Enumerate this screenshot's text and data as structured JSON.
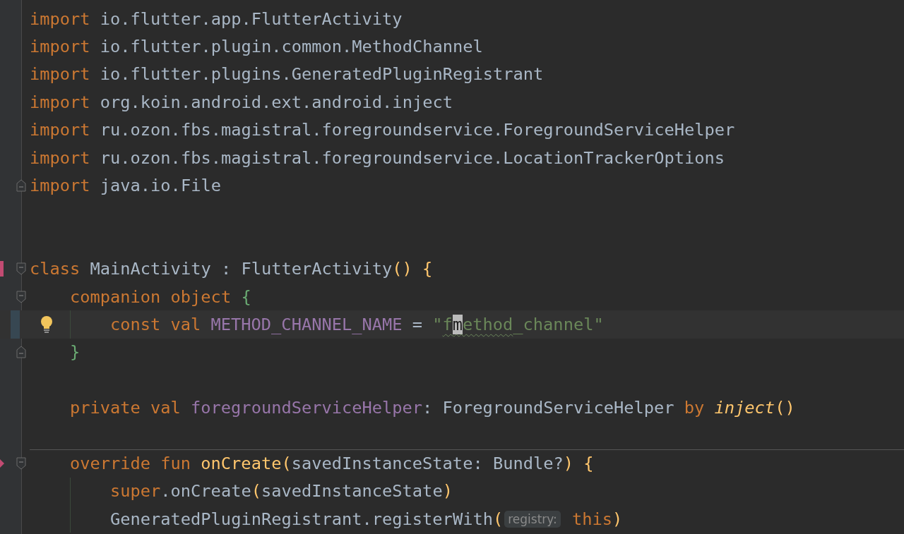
{
  "editor": {
    "lines": [
      {
        "kind": "code",
        "tokens": [
          {
            "kind": "kw",
            "text": "import"
          },
          {
            "kind": "plain",
            "text": "io.flutter.app.FlutterActivity",
            "space": true
          }
        ]
      },
      {
        "kind": "code",
        "tokens": [
          {
            "kind": "kw",
            "text": "import"
          },
          {
            "kind": "plain",
            "text": "io.flutter.plugin.common.MethodChannel",
            "space": true
          }
        ]
      },
      {
        "kind": "code",
        "tokens": [
          {
            "kind": "kw",
            "text": "import"
          },
          {
            "kind": "plain",
            "text": "io.flutter.plugins.GeneratedPluginRegistrant",
            "space": true
          }
        ]
      },
      {
        "kind": "code",
        "tokens": [
          {
            "kind": "kw",
            "text": "import"
          },
          {
            "kind": "plain",
            "text": "org.koin.android.ext.android.inject",
            "space": true
          }
        ]
      },
      {
        "kind": "code",
        "tokens": [
          {
            "kind": "kw",
            "text": "import"
          },
          {
            "kind": "plain",
            "text": "ru.ozon.fbs.magistral.foregroundservice.ForegroundServiceHelper",
            "space": true
          }
        ]
      },
      {
        "kind": "code",
        "tokens": [
          {
            "kind": "kw",
            "text": "import"
          },
          {
            "kind": "plain",
            "text": "ru.ozon.fbs.magistral.foregroundservice.LocationTrackerOptions",
            "space": true
          }
        ]
      },
      {
        "kind": "code",
        "fold_end": true,
        "tokens": [
          {
            "kind": "kw",
            "text": "import"
          },
          {
            "kind": "plain",
            "text": "java.io.File",
            "space": true
          }
        ]
      },
      {
        "kind": "blank"
      },
      {
        "kind": "blank"
      },
      {
        "kind": "code",
        "fold_start": true,
        "change_bar": true,
        "tokens": [
          {
            "kind": "kw",
            "text": "class"
          },
          {
            "kind": "plain",
            "text": "MainActivity",
            "space": true
          },
          {
            "kind": "plain",
            "text": ":",
            "space": true
          },
          {
            "kind": "plain",
            "text": "FlutterActivity",
            "space": true
          },
          {
            "kind": "paren",
            "text": "()"
          },
          {
            "kind": "paren",
            "text": "{",
            "space": true
          }
        ],
        "children": [
          {
            "kind": "code",
            "fold_start": true,
            "tokens": [
              {
                "kind": "kw",
                "text": "companion"
              },
              {
                "kind": "kw",
                "text": "object",
                "space": true
              },
              {
                "kind": "brace",
                "text": "{",
                "space": true
              }
            ],
            "children": [
              {
                "kind": "code",
                "current": true,
                "intention": true,
                "tokens": [
                  {
                    "kind": "kw",
                    "text": "const"
                  },
                  {
                    "kind": "kw",
                    "text": "val",
                    "space": true
                  },
                  {
                    "kind": "prop",
                    "text": "METHOD_CHANNEL_NAME",
                    "space": true
                  },
                  {
                    "kind": "plain",
                    "text": "=",
                    "space": true
                  },
                  {
                    "kind": "string",
                    "space": true,
                    "segments": [
                      {
                        "text": "\"",
                        "typo": false,
                        "caret": false
                      },
                      {
                        "text": "f",
                        "typo": true,
                        "caret": false
                      },
                      {
                        "text": "m",
                        "typo": true,
                        "caret": true
                      },
                      {
                        "text": "ethod",
                        "typo": true,
                        "caret": false
                      },
                      {
                        "text": "_channel\"",
                        "typo": false,
                        "caret": false
                      }
                    ]
                  }
                ]
              }
            ]
          },
          {
            "kind": "code",
            "fold_end": true,
            "tokens": [
              {
                "kind": "brace",
                "text": "}"
              }
            ]
          },
          {
            "kind": "blank"
          },
          {
            "kind": "code",
            "tokens": [
              {
                "kind": "kw",
                "text": "private"
              },
              {
                "kind": "kw",
                "text": "val",
                "space": true
              },
              {
                "kind": "prop",
                "text": "foregroundServiceHelper",
                "space": true
              },
              {
                "kind": "plain",
                "text": ":"
              },
              {
                "kind": "plain",
                "text": "ForegroundServiceHelper",
                "space": true
              },
              {
                "kind": "kw",
                "text": "by",
                "space": true
              },
              {
                "kind": "call",
                "text": "inject",
                "space": true
              },
              {
                "kind": "paren",
                "text": "()"
              }
            ]
          },
          {
            "kind": "blank"
          },
          {
            "kind": "code",
            "fold_start": true,
            "change_arrow": true,
            "separator": true,
            "tokens": [
              {
                "kind": "kw",
                "text": "override"
              },
              {
                "kind": "kw",
                "text": "fun",
                "space": true
              },
              {
                "kind": "fn",
                "text": "onCreate",
                "space": true
              },
              {
                "kind": "paren",
                "text": "("
              },
              {
                "kind": "plain",
                "text": "savedInstanceState:"
              },
              {
                "kind": "plain",
                "text": "Bundle?",
                "space": true
              },
              {
                "kind": "paren",
                "text": ")"
              },
              {
                "kind": "paren",
                "text": "{",
                "space": true
              }
            ],
            "children": [
              {
                "kind": "code",
                "tokens": [
                  {
                    "kind": "kw",
                    "text": "super"
                  },
                  {
                    "kind": "plain",
                    "text": ".onCreate"
                  },
                  {
                    "kind": "paren",
                    "text": "("
                  },
                  {
                    "kind": "plain",
                    "text": "savedInstanceState"
                  },
                  {
                    "kind": "paren",
                    "text": ")"
                  }
                ]
              },
              {
                "kind": "code",
                "tokens": [
                  {
                    "kind": "plain",
                    "text": "GeneratedPluginRegistrant.registerWith"
                  },
                  {
                    "kind": "paren",
                    "text": "("
                  },
                  {
                    "kind": "hint",
                    "text": "registry:"
                  },
                  {
                    "kind": "kw",
                    "text": "this",
                    "space": true
                  },
                  {
                    "kind": "paren",
                    "text": ")"
                  }
                ]
              }
            ]
          }
        ]
      }
    ]
  }
}
